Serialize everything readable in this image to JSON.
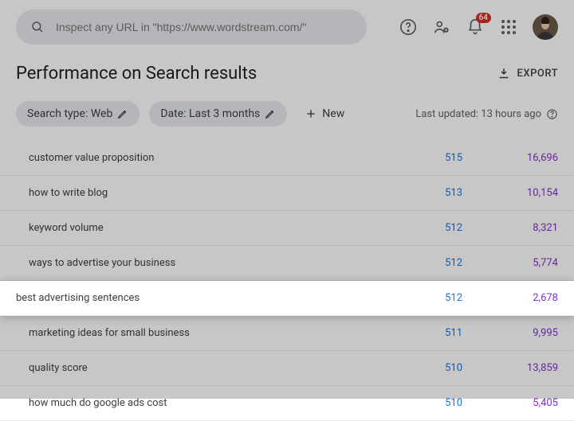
{
  "search": {
    "placeholder": "Inspect any URL in \"https://www.wordstream.com/\""
  },
  "notifications": {
    "count": "64"
  },
  "page": {
    "title": "Performance on Search results",
    "export_label": "EXPORT"
  },
  "filters": {
    "search_type": "Search type: Web",
    "date": "Date: Last 3 months",
    "new_label": "New",
    "last_updated": "Last updated: 13 hours ago"
  },
  "rows": [
    {
      "query": "customer value proposition",
      "m1": "515",
      "m2": "16,696",
      "highlight": false
    },
    {
      "query": "how to write blog",
      "m1": "513",
      "m2": "10,154",
      "highlight": false
    },
    {
      "query": "keyword volume",
      "m1": "512",
      "m2": "8,321",
      "highlight": false
    },
    {
      "query": "ways to advertise your business",
      "m1": "512",
      "m2": "5,774",
      "highlight": false
    },
    {
      "query": "best advertising sentences",
      "m1": "512",
      "m2": "2,678",
      "highlight": true
    },
    {
      "query": "marketing ideas for small business",
      "m1": "511",
      "m2": "9,995",
      "highlight": false
    },
    {
      "query": "quality score",
      "m1": "510",
      "m2": "13,859",
      "highlight": false
    },
    {
      "query": "how much do google ads cost",
      "m1": "510",
      "m2": "5,405",
      "highlight": false
    }
  ]
}
